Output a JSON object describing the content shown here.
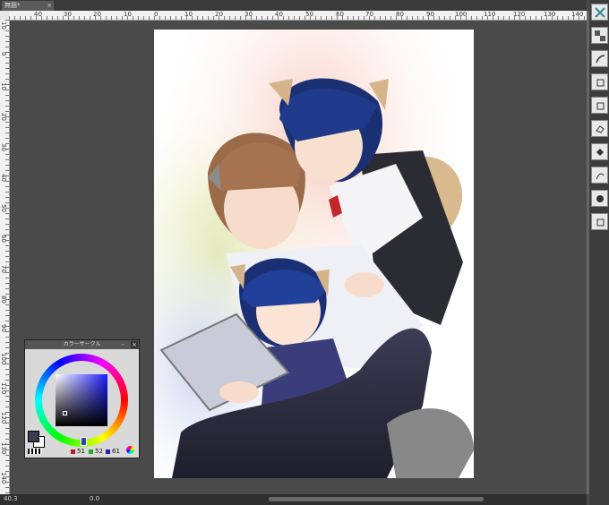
{
  "document": {
    "tab_title": "無題*",
    "tab_close": "×"
  },
  "ruler": {
    "top_labels": [
      "40",
      "30",
      "20",
      "10",
      "0",
      "10",
      "20",
      "30",
      "40",
      "50",
      "60",
      "70",
      "80",
      "90",
      "100",
      "110",
      "120",
      "130",
      "140"
    ],
    "left_labels": [
      "10",
      "0",
      "10",
      "20",
      "30",
      "40",
      "50",
      "60",
      "70",
      "80",
      "90",
      "100",
      "110",
      "120",
      "130",
      "140"
    ]
  },
  "status": {
    "zoom": "40.3",
    "angle": "0.0"
  },
  "color_panel": {
    "title": "カラーサークル",
    "close": "×",
    "minimize": "-",
    "rgb": {
      "r": "51",
      "g": "52",
      "b": "61"
    },
    "colors": {
      "r_swatch": "#aa2222",
      "g_swatch": "#22aa22",
      "b_swatch": "#2222aa",
      "foreground": "#3a3a52",
      "background": "#ffffff"
    }
  },
  "tools": [
    "layer-move-icon",
    "checker-icon",
    "pen-icon",
    "brush-icon",
    "airbrush-icon",
    "eraser-icon",
    "fill-icon",
    "blend-icon",
    "gradient-icon",
    "decorate-icon",
    "shape-icon"
  ],
  "artwork": {
    "description_icon": "illustration-canvas"
  }
}
